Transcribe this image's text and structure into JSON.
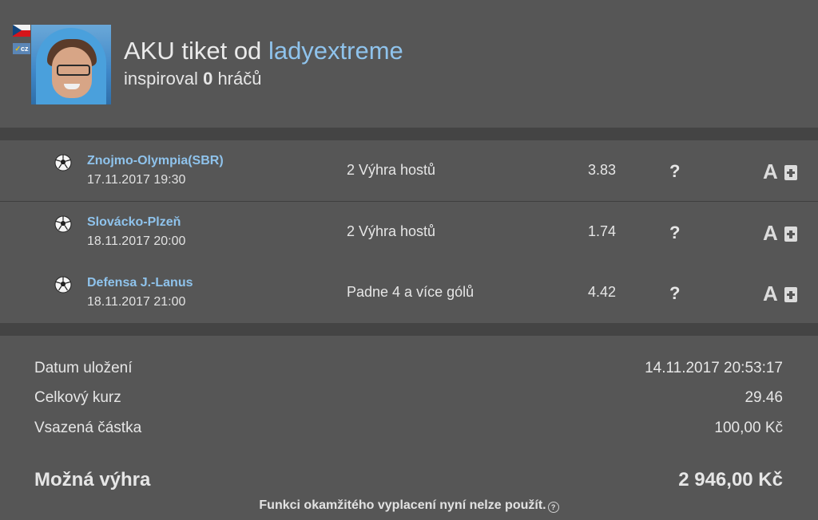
{
  "header": {
    "title_prefix": "AKU tiket od",
    "username": "ladyextreme",
    "inspired_prefix": "inspiroval",
    "inspired_count": "0",
    "inspired_suffix": "hráčů",
    "country_badge": "cz"
  },
  "bets": [
    {
      "match": "Znojmo-Olympia(SBR)",
      "date": "17.11.2017 19:30",
      "tip": "2 Výhra hostů",
      "odds": "3.83",
      "status": "?",
      "action": "A"
    },
    {
      "match": "Slovácko-Plzeň",
      "date": "18.11.2017 20:00",
      "tip": "2 Výhra hostů",
      "odds": "1.74",
      "status": "?",
      "action": "A"
    },
    {
      "match": "Defensa J.-Lanus",
      "date": "18.11.2017 21:00",
      "tip": "Padne 4 a více gólů",
      "odds": "4.42",
      "status": "?",
      "action": "A"
    }
  ],
  "summary": {
    "saved_label": "Datum uložení",
    "saved_value": "14.11.2017 20:53:17",
    "total_odds_label": "Celkový kurz",
    "total_odds_value": "29.46",
    "stake_label": "Vsazená částka",
    "stake_value": "100,00 Kč",
    "win_label": "Možná výhra",
    "win_value": "2 946,00 Kč",
    "notice": "Funkci okamžitého vyplacení nyní nelze použít.",
    "help_glyph": "?"
  },
  "icons": {
    "sport": "soccer-ball-icon",
    "status": "question-icon",
    "add": "add-box-icon"
  },
  "colors": {
    "background": "#565656",
    "separator": "#444444",
    "link": "#8fc3ec",
    "text": "#e6e6e6"
  }
}
